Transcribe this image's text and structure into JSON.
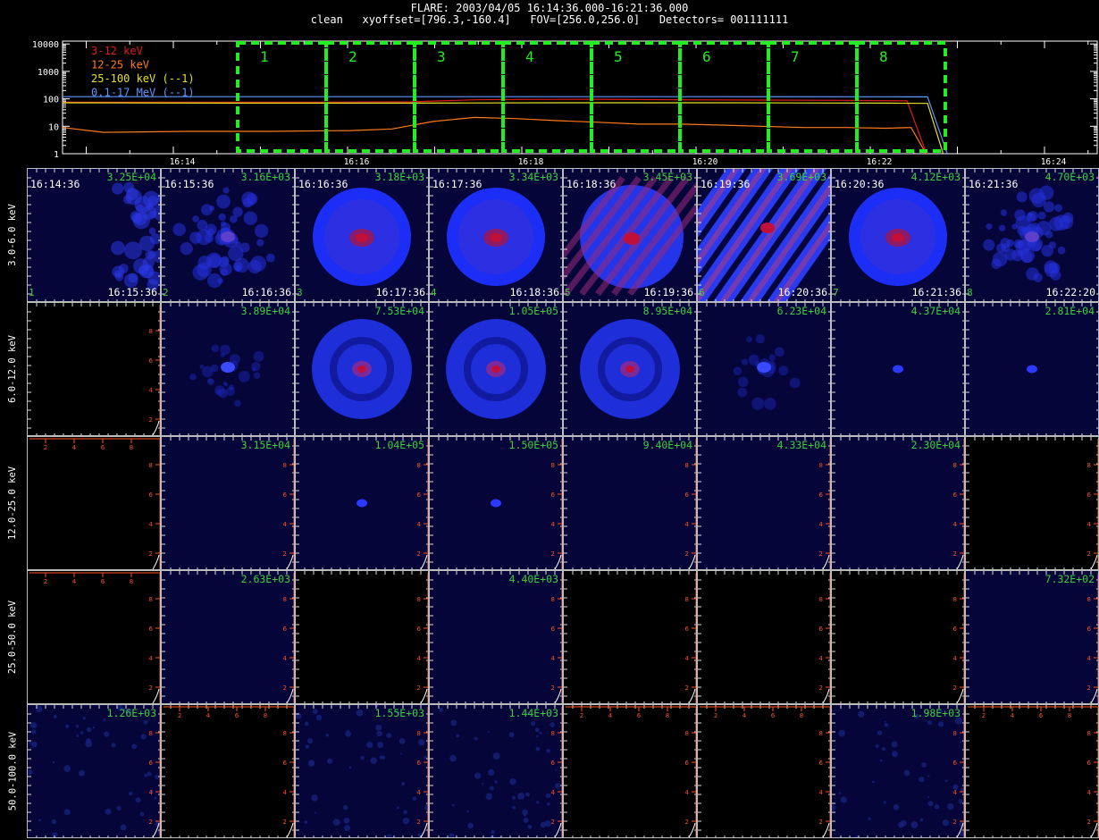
{
  "header": {
    "line1": "FLARE: 2003/04/05 16:14:36.000-16:21:36.000",
    "line2": "clean   xyoffset=[796.3,-160.4]   FOV=[256.0,256.0]   Detectors= 001111111"
  },
  "chart_data": [
    {
      "type": "line",
      "title": "",
      "yscale": "log",
      "ylim": [
        1,
        10000
      ],
      "ytick_labels": [
        "1",
        "10",
        "100",
        "1000",
        "10000"
      ],
      "xtick_labels": [
        "16:14",
        "16:16",
        "16:18",
        "16:20",
        "16:22",
        "16:24"
      ],
      "series": [
        {
          "name": "3-12 keV",
          "color": "#e01a1a",
          "points": [
            [
              0,
              75
            ],
            [
              3,
              76
            ],
            [
              6,
              76
            ],
            [
              8.5,
              78
            ],
            [
              10,
              92
            ],
            [
              11,
              95
            ],
            [
              13,
              96
            ],
            [
              15,
              92
            ],
            [
              17,
              90
            ],
            [
              19,
              88
            ],
            [
              20.5,
              84
            ],
            [
              21,
              0.8
            ]
          ]
        },
        {
          "name": "12-25 keV",
          "color": "#ff7a1a",
          "points": [
            [
              0,
              9
            ],
            [
              1,
              6
            ],
            [
              3,
              6.5
            ],
            [
              5,
              6.5
            ],
            [
              7,
              7
            ],
            [
              8,
              8
            ],
            [
              9,
              15
            ],
            [
              10,
              21
            ],
            [
              11,
              19
            ],
            [
              12,
              16
            ],
            [
              13,
              14
            ],
            [
              14,
              12
            ],
            [
              15,
              12
            ],
            [
              16,
              11
            ],
            [
              18,
              9
            ],
            [
              19,
              9
            ],
            [
              20,
              8.5
            ],
            [
              20.6,
              9
            ],
            [
              21,
              0.8
            ]
          ]
        },
        {
          "name": "25-100 keV (--1)",
          "color": "#e8e020",
          "points": [
            [
              0,
              72
            ],
            [
              4,
              70
            ],
            [
              8,
              70
            ],
            [
              10,
              71
            ],
            [
              12,
              72
            ],
            [
              16,
              72
            ],
            [
              20,
              70
            ],
            [
              21,
              68
            ],
            [
              21.4,
              0.8
            ]
          ]
        },
        {
          "name": "0.1-17 MeV (--1)",
          "color": "#5f95ff",
          "points": [
            [
              0,
              120
            ],
            [
              5,
              120
            ],
            [
              10,
              120
            ],
            [
              15,
              120
            ],
            [
              20,
              119
            ],
            [
              21,
              118
            ],
            [
              21.5,
              0.8
            ]
          ]
        }
      ],
      "time_bins": [
        "1",
        "2",
        "3",
        "4",
        "5",
        "6",
        "7",
        "8"
      ]
    },
    {
      "type": "heatmap",
      "energy_bands": [
        "3.0-6.0 keV",
        "6.0-12.0 keV",
        "12.0-25.0 keV",
        "25.0-50.0 keV",
        "50.0-100.0 keV"
      ],
      "start_times": [
        "16:14:36",
        "16:15:36",
        "16:16:36",
        "16:17:36",
        "16:18:36",
        "16:19:36",
        "16:20:36",
        "16:21:36"
      ],
      "end_times": [
        "16:15:36",
        "16:16:36",
        "16:17:36",
        "16:18:36",
        "16:19:36",
        "16:20:36",
        "16:21:36",
        "16:22:20"
      ],
      "frame_numbers": [
        "1",
        "2",
        "3",
        "4",
        "5",
        "6",
        "7",
        "8"
      ],
      "peaks": [
        [
          "3.25E+04",
          "3.16E+03",
          "3.18E+03",
          "3.34E+03",
          "3.45E+03",
          "3.69E+03",
          "4.12E+03",
          "4.70E+03"
        ],
        [
          "",
          "3.89E+04",
          "7.53E+04",
          "1.05E+05",
          "8.95E+04",
          "6.23E+04",
          "4.37E+04",
          "2.81E+04"
        ],
        [
          "",
          "3.15E+04",
          "1.04E+05",
          "1.50E+05",
          "9.40E+04",
          "4.33E+04",
          "2.30E+04",
          ""
        ],
        [
          "",
          "2.63E+03",
          "",
          "4.40E+03",
          "",
          "",
          "",
          "7.32E+02"
        ],
        [
          "1.26E+03",
          "",
          "1.55E+03",
          "1.44E+03",
          "",
          "",
          "1.98E+03",
          ""
        ]
      ],
      "image_styles": [
        [
          "corner",
          "blob",
          "disk",
          "disk",
          "striped",
          "streaks",
          "disk",
          "blob"
        ],
        [
          "blank",
          "smallblob",
          "ring",
          "ring",
          "ring",
          "smallblob",
          "dot",
          "dot"
        ],
        [
          "axes",
          "empty",
          "dot",
          "dot",
          "empty",
          "empty",
          "empty",
          "blank"
        ],
        [
          "axes",
          "empty",
          "blank",
          "empty",
          "blank",
          "blank",
          "blank",
          "empty"
        ],
        [
          "noise",
          "blank",
          "noise",
          "noise",
          "blank",
          "blank",
          "noise",
          "blank"
        ]
      ],
      "dummy_axis_ticks": [
        "2",
        "4",
        "6",
        "8"
      ],
      "colors": {
        "cell_bg": "#05053a",
        "ring": "#2a3dff",
        "core": "#c0103a",
        "grid": "#bcbcbc",
        "axes": "#ff4f1f",
        "peak_text": "#3bd13b"
      }
    }
  ]
}
